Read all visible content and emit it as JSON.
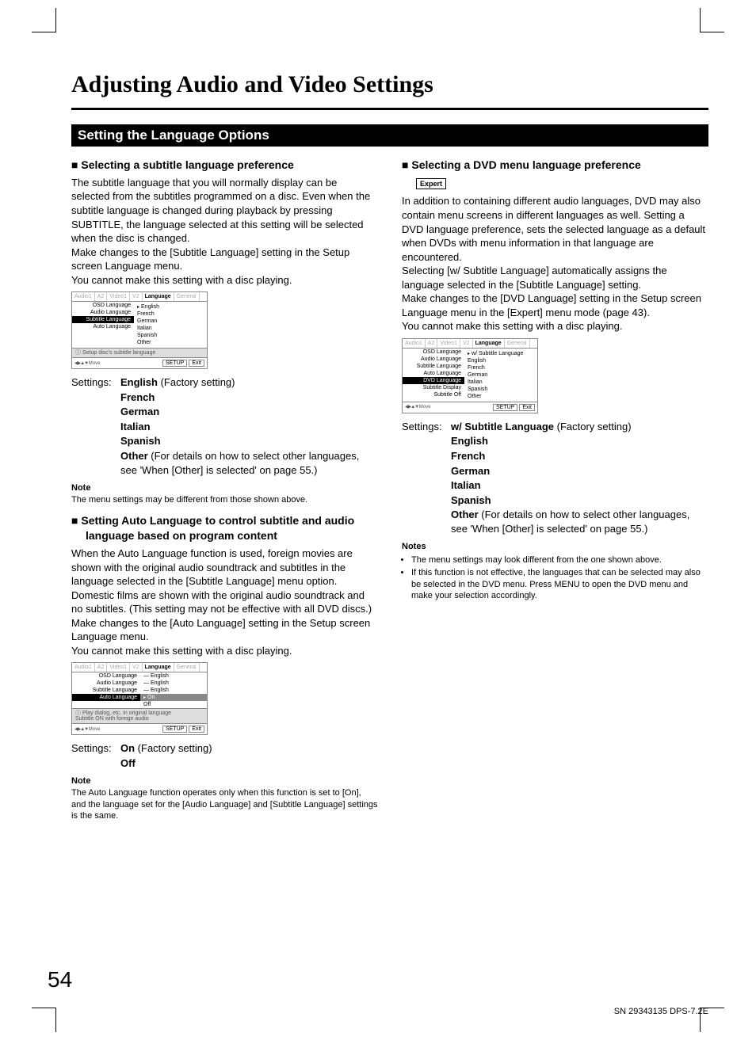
{
  "page": {
    "title": "Adjusting Audio and Video Settings",
    "section": "Setting the Language Options",
    "number": "54",
    "footer": "SN 29343135 DPS-7.2E"
  },
  "left": {
    "h1": "Selecting a subtitle language preference",
    "body": "The subtitle language that you will normally display can be selected from the subtitles programmed on a disc. Even when the subtitle language is changed during playback by pressing SUBTITLE, the language selected at this setting will be selected when the disc is changed.\nMake changes to the [Subtitle Language] setting in the Setup screen Language menu.\nYou cannot make this setting with a disc playing.",
    "osd1": {
      "tabs": [
        "Audio1",
        "A2",
        "Video1",
        "V2",
        "Language",
        "General"
      ],
      "active_tab": 4,
      "rows": [
        "OSD Language",
        "Audio Language",
        "Subtitle Language",
        "Auto Language"
      ],
      "hl_row": 2,
      "vals": [
        "English",
        "French",
        "German",
        "Italian",
        "Spanish",
        "Other"
      ],
      "info": "Setup disc's subtitle language",
      "move": "Move",
      "setup": "SETUP",
      "exit": "Exit"
    },
    "settings_label": "Settings:",
    "settings1": [
      {
        "label": "English",
        "factory": true
      },
      {
        "label": "French"
      },
      {
        "label": "German"
      },
      {
        "label": "Italian"
      },
      {
        "label": "Spanish"
      },
      {
        "label": "Other",
        "extra": " (For details on how to select other languages, see 'When [Other] is selected' on page 55.)"
      }
    ],
    "note1_hd": "Note",
    "note1": "The menu settings may be different from those shown above.",
    "h2": "Setting Auto Language to control subtitle and audio language based on program content",
    "body2": "When the Auto Language function is used, foreign movies are shown with the original audio soundtrack and subtitles in the language selected in the [Subtitle Language] menu option. Domestic films are shown with the original audio soundtrack and no subtitles. (This setting may not be effective with all DVD discs.)\nMake changes to the [Auto Language] setting in the Setup screen Language menu.\nYou cannot make this setting with a disc playing.",
    "osd2": {
      "tabs": [
        "Audio1",
        "A2",
        "Video1",
        "V2",
        "Language",
        "General"
      ],
      "rows": [
        {
          "l": "OSD Language",
          "r": "English"
        },
        {
          "l": "Audio Language",
          "r": "English"
        },
        {
          "l": "Subtitle Language",
          "r": "English"
        },
        {
          "l": "Auto Language",
          "r": "On",
          "hl": true
        },
        {
          "l": "",
          "r": "Off"
        }
      ],
      "info": "Play dialog, etc. in original language\nSubtitle ON with foreign audio",
      "move": "Move"
    },
    "settings2": [
      {
        "label": "On",
        "factory": true
      },
      {
        "label": "Off"
      }
    ],
    "note2_hd": "Note",
    "note2": "The Auto Language function operates only when this function is set to [On], and the language set for the [Audio Language] and [Subtitle Language] settings is the same."
  },
  "right": {
    "h1": "Selecting a DVD menu language preference",
    "expert": "Expert",
    "body": "In addition to containing different audio languages, DVD may also contain menu screens in different languages as well. Setting a DVD language preference, sets the selected language as a default when DVDs with menu information in that language are encountered.\nSelecting [w/ Subtitle Language] automatically assigns the language selected in the [Subtitle Language] setting.\nMake changes to the [DVD Language] setting in the Setup screen Language menu in the [Expert] menu mode (page 43).\nYou cannot make this setting with a disc playing.",
    "osd": {
      "tabs": [
        "Audio1",
        "A2",
        "Video1",
        "V2",
        "Language",
        "General"
      ],
      "rows": [
        "OSD Language",
        "Audio Language",
        "Subtitle Language",
        "Auto Language",
        "DVD Language",
        "Subtitle Display",
        "Subtitle Off"
      ],
      "hl_row": 4,
      "vals": [
        "w/ Subtitle Language",
        "English",
        "French",
        "German",
        "Italian",
        "Spanish",
        "Other"
      ],
      "move": "Move"
    },
    "settings_label": "Settings:",
    "settings": [
      {
        "label": "w/ Subtitle Language",
        "factory": true
      },
      {
        "label": "English"
      },
      {
        "label": "French"
      },
      {
        "label": "German"
      },
      {
        "label": "Italian"
      },
      {
        "label": "Spanish"
      },
      {
        "label": "Other",
        "extra": " (For details on how to select other languages, see 'When [Other] is selected' on page 55.)"
      }
    ],
    "notes_hd": "Notes",
    "notes": [
      "The menu settings may look different from the one shown above.",
      "If this function is not effective, the languages that can be selected may also be selected in the DVD menu. Press MENU to open the DVD menu and make your selection accordingly."
    ]
  }
}
